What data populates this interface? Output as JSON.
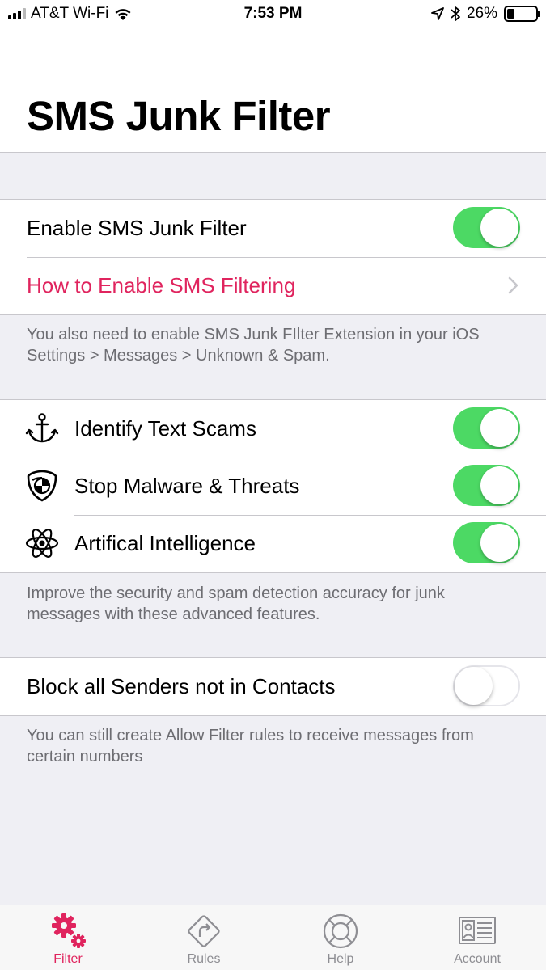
{
  "status_bar": {
    "carrier": "AT&T Wi-Fi",
    "time": "7:53 PM",
    "battery": "26%",
    "battery_level": 0.26
  },
  "header": {
    "title": "SMS Junk Filter"
  },
  "section1": {
    "enable_label": "Enable SMS Junk Filter",
    "enable_on": true,
    "howto_label": "How to Enable SMS Filtering",
    "footer": "You also need to enable SMS Junk FIlter Extension in your iOS Settings > Messages > Unknown & Spam."
  },
  "section2": {
    "items": [
      {
        "label": "Identify Text Scams",
        "icon": "anchor-icon",
        "on": true
      },
      {
        "label": "Stop Malware & Threats",
        "icon": "shield-icon",
        "on": true
      },
      {
        "label": "Artifical Intelligence",
        "icon": "atom-icon",
        "on": true
      }
    ],
    "footer": "Improve the security and spam detection accuracy for junk messages with these advanced features."
  },
  "section3": {
    "block_label": "Block all Senders not in Contacts",
    "block_on": false,
    "footer": "You can still create Allow Filter rules to receive messages from certain numbers"
  },
  "tab_bar": {
    "tabs": [
      {
        "label": "Filter",
        "icon": "gears-icon",
        "active": true
      },
      {
        "label": "Rules",
        "icon": "rules-sign-icon",
        "active": false
      },
      {
        "label": "Help",
        "icon": "lifebuoy-icon",
        "active": false
      },
      {
        "label": "Account",
        "icon": "id-card-icon",
        "active": false
      }
    ]
  },
  "colors": {
    "accent": "#e0245e",
    "toggle_on": "#4cd964",
    "background": "#efeff4"
  }
}
